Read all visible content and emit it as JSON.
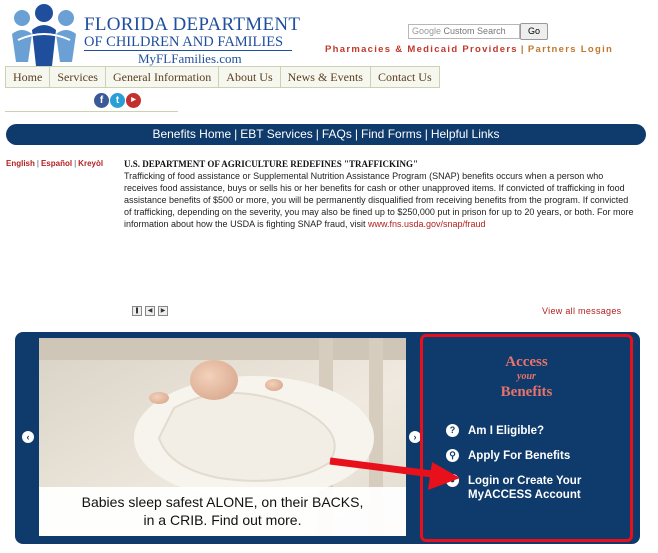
{
  "header": {
    "logo_line1": "FLORIDA DEPARTMENT",
    "logo_line2": "OF CHILDREN AND FAMILIES",
    "logo_line3": "MyFLFamilies.com",
    "search_google": "Google",
    "search_placeholder": "Custom Search",
    "search_button": "Go",
    "link_providers": "Pharmacies & Medicaid Providers",
    "link_separator": "|",
    "link_partners": "Partners Login"
  },
  "nav": {
    "tabs": [
      "Home",
      "Services",
      "General Information",
      "About Us",
      "News & Events",
      "Contact Us"
    ],
    "social": [
      "facebook-icon",
      "twitter-icon",
      "youtube-icon"
    ]
  },
  "benefits_bar": {
    "links": [
      "Benefits Home",
      "EBT Services",
      "FAQs",
      "Find Forms",
      "Helpful Links"
    ],
    "separator": "|"
  },
  "languages": [
    "English",
    "Español",
    "Kreyòl"
  ],
  "news": {
    "title": "U.S. DEPARTMENT OF AGRICULTURE REDEFINES \"TRAFFICKING\"",
    "body": "Trafficking of food assistance or Supplemental Nutrition Assistance Program (SNAP) benefits occurs when a person who receives food assistance, buys or sells his or her benefits for cash or other unapproved items. If convicted of trafficking in food assistance benefits of $500 or more, you will be permanently disqualified from receiving benefits from the program. If convicted of trafficking, depending on the severity, you may also be fined up to $250,000 put in prison for up to 20 years, or both. For more information about how the USDA is fighting SNAP fraud, visit ",
    "link": "www.fns.usda.gov/snap/fraud",
    "view_all": "View all messages"
  },
  "carousel": {
    "caption_line1": "Babies sleep safest ALONE, on their BACKS,",
    "caption_line2": "in a CRIB. Find out more."
  },
  "access": {
    "title_line1": "Access",
    "title_line2": "your",
    "title_line3": "Benefits",
    "items": [
      {
        "icon": "question-icon",
        "glyph": "?",
        "label": "Am I Eligible?"
      },
      {
        "icon": "search-icon",
        "glyph": "⚲",
        "label": "Apply For Benefits"
      },
      {
        "icon": "user-icon",
        "glyph": "●",
        "label_line1": "Login or Create Your",
        "label_line2": "MyACCESS Account"
      }
    ]
  },
  "colors": {
    "navy": "#0e3a6c",
    "red_link": "#b22222",
    "highlight_red": "#e8101a",
    "salmon": "#e8736a"
  }
}
